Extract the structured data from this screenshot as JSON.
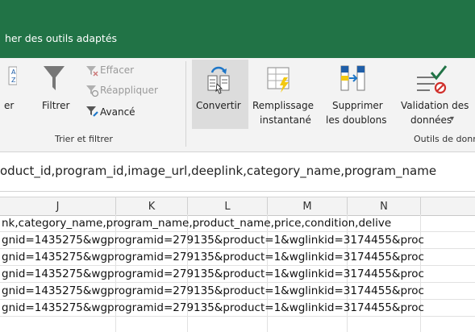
{
  "top": {
    "tell_me": "her des outils adaptés"
  },
  "ribbon": {
    "partial_left_label": "er",
    "sort_icon_letters": "A\nZ",
    "filter": {
      "label": "Filtrer"
    },
    "clear": {
      "label": "Effacer"
    },
    "reapply": {
      "label": "Réappliquer"
    },
    "advanced": {
      "label": "Avancé"
    },
    "sort_filter_group": "Trier et filtrer",
    "convert": {
      "label": "Convertir"
    },
    "flash_fill": {
      "line1": "Remplissage",
      "line2": "instantané"
    },
    "remove_duplicates": {
      "line1": "Supprimer",
      "line2": "les doublons"
    },
    "data_validation": {
      "line1": "Validation des",
      "line2": "données",
      "arrow": "▾"
    },
    "data_tools_group": "Outils de donn"
  },
  "formula_bar": {
    "content": "oduct_id,program_id,image_url,deeplink,category_name,program_name"
  },
  "columns": [
    "J",
    "K",
    "L",
    "M",
    "N"
  ],
  "rows": [
    "nk,category_name,program_name,product_name,price,condition,delive",
    "gnid=1435275&wgprogramid=279135&product=1&wglinkid=3174455&proc",
    "gnid=1435275&wgprogramid=279135&product=1&wglinkid=3174455&proc",
    "gnid=1435275&wgprogramid=279135&product=1&wglinkid=3174455&proc",
    "gnid=1435275&wgprogramid=279135&product=1&wglinkid=3174455&proc",
    "gnid=1435275&wgprogramid=279135&product=1&wglinkid=3174455&proc"
  ],
  "colors": {
    "excel_green": "#217346",
    "ribbon_bg": "#f3f3f3",
    "hover": "#dcdcdc"
  }
}
